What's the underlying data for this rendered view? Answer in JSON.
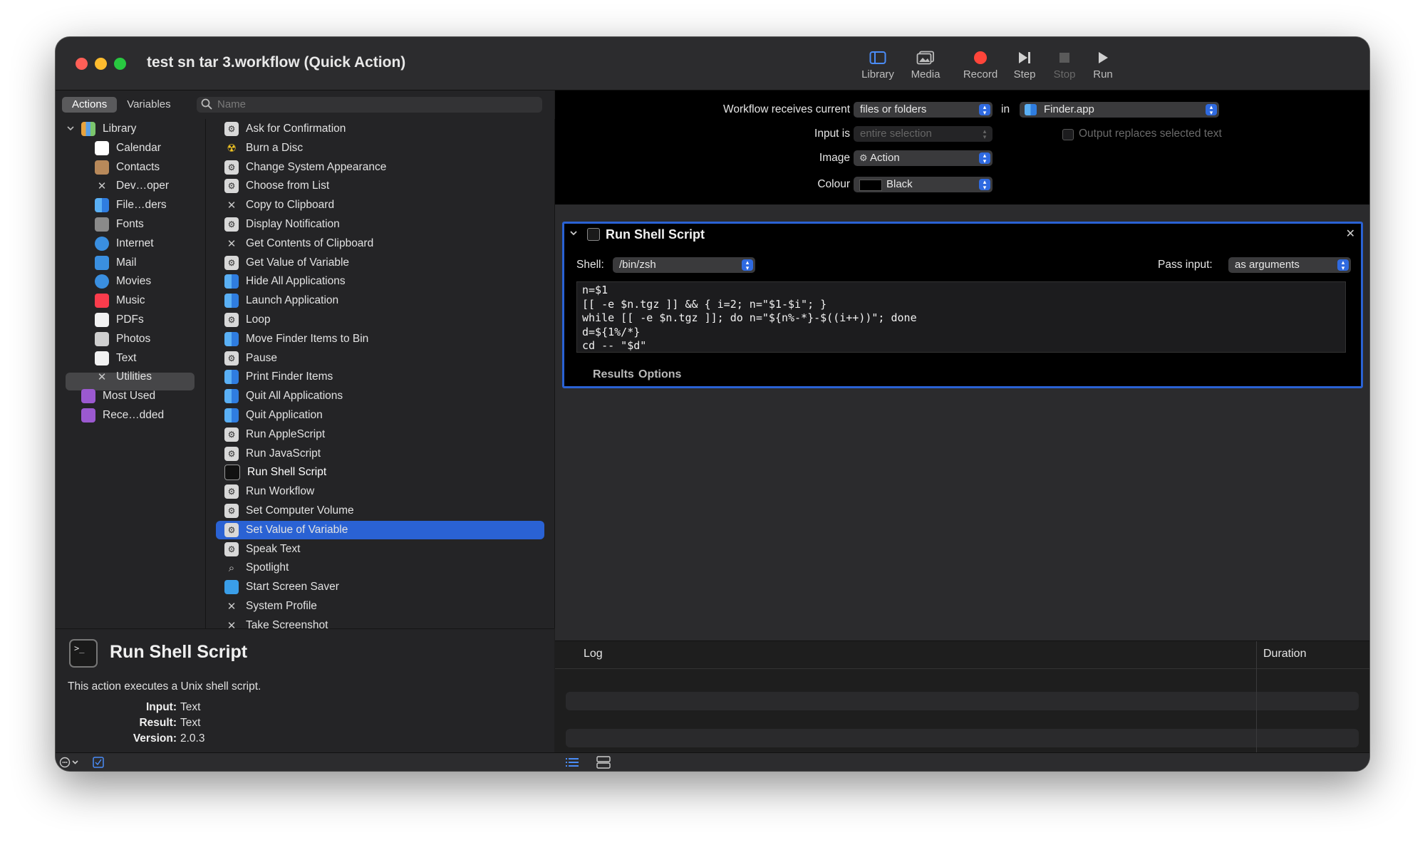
{
  "window": {
    "title": "test sn tar 3.workflow (Quick Action)"
  },
  "toolbar": {
    "library": "Library",
    "media": "Media",
    "record": "Record",
    "step": "Step",
    "stop": "Stop",
    "run": "Run"
  },
  "left": {
    "tabs": [
      "Actions",
      "Variables"
    ],
    "search_placeholder": "Name",
    "library": [
      {
        "label": "Library",
        "icon": "books-icon"
      },
      {
        "label": "Calendar",
        "icon": "calendar-icon"
      },
      {
        "label": "Contacts",
        "icon": "contacts-icon"
      },
      {
        "label": "Dev…oper",
        "icon": "tools-icon"
      },
      {
        "label": "File…ders",
        "icon": "finder-icon"
      },
      {
        "label": "Fonts",
        "icon": "fonts-icon"
      },
      {
        "label": "Internet",
        "icon": "globe-icon"
      },
      {
        "label": "Mail",
        "icon": "mail-icon"
      },
      {
        "label": "Movies",
        "icon": "movies-icon"
      },
      {
        "label": "Music",
        "icon": "music-icon"
      },
      {
        "label": "PDFs",
        "icon": "pdf-icon"
      },
      {
        "label": "Photos",
        "icon": "photos-icon"
      },
      {
        "label": "Text",
        "icon": "text-icon"
      },
      {
        "label": "Utilities",
        "icon": "tools-icon"
      },
      {
        "label": "Most Used",
        "icon": "smart-folder-icon"
      },
      {
        "label": "Rece…dded",
        "icon": "smart-folder-icon"
      }
    ],
    "actions": [
      "Ask for Confirmation",
      "Burn a Disc",
      "Change System Appearance",
      "Choose from List",
      "Copy to Clipboard",
      "Display Notification",
      "Get Contents of Clipboard",
      "Get Value of Variable",
      "Hide All Applications",
      "Launch Application",
      "Loop",
      "Move Finder Items to Bin",
      "Pause",
      "Print Finder Items",
      "Quit All Applications",
      "Quit Application",
      "Run AppleScript",
      "Run JavaScript",
      "Run Shell Script",
      "Run Workflow",
      "Set Computer Volume",
      "Set Value of Variable",
      "Speak Text",
      "Spotlight",
      "Start Screen Saver",
      "System Profile",
      "Take Screenshot"
    ],
    "description": {
      "title": "Run Shell Script",
      "text": "This action executes a Unix shell script.",
      "input_label": "Input:",
      "input_value": "Text",
      "result_label": "Result:",
      "result_value": "Text",
      "version_label": "Version:",
      "version_value": "2.0.3"
    }
  },
  "workflow": {
    "receives_label": "Workflow receives current",
    "receives_value": "files or folders",
    "in_label": "in",
    "app_value": "Finder.app",
    "input_is_label": "Input is",
    "input_is_value": "entire selection",
    "output_replaces": "Output replaces selected text",
    "image_label": "Image",
    "image_value": "Action",
    "colour_label": "Colour",
    "colour_value": "Black"
  },
  "action": {
    "title": "Run Shell Script",
    "shell_label": "Shell:",
    "shell_value": "/bin/zsh",
    "pass_label": "Pass input:",
    "pass_value": "as arguments",
    "script": "n=$1\n[[ -e $n.tgz ]] && { i=2; n=\"$1-$i\"; }\nwhile [[ -e $n.tgz ]]; do n=\"${n%-*}-$((i++))\"; done\nd=${1%/*}\ncd -- \"$d\"",
    "results_tab": "Results",
    "options_tab": "Options"
  },
  "log": {
    "log_header": "Log",
    "duration_header": "Duration"
  },
  "colors": {
    "accent": "#2a62d4",
    "record": "#ff453a"
  }
}
